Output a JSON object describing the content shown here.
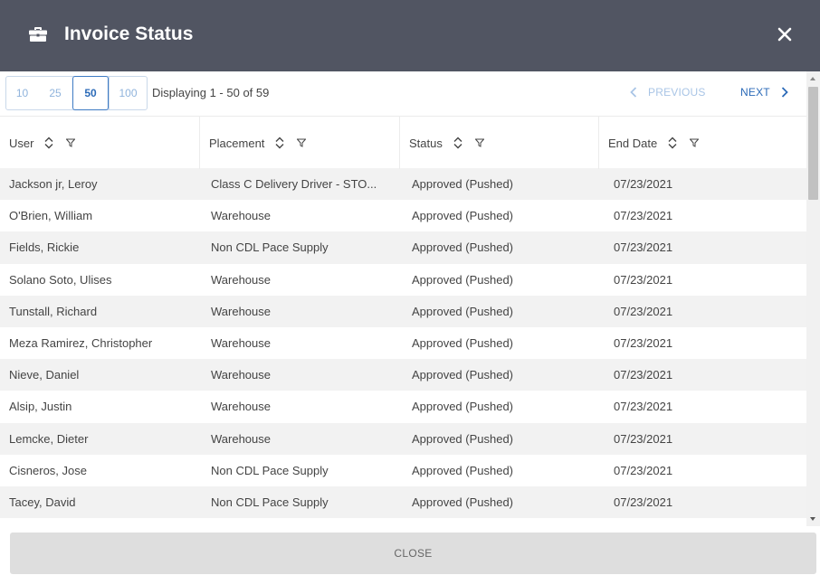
{
  "header": {
    "title": "Invoice Status",
    "title_icon": "briefcase-icon",
    "close_icon": "close-icon",
    "background": "#515562"
  },
  "pager": {
    "page_sizes": [
      "10",
      "25",
      "50",
      "100"
    ],
    "selected_page_size": "50",
    "displaying": "Displaying 1 - 50 of 59",
    "previous_label": "PREVIOUS",
    "next_label": "NEXT",
    "accent": "#2c6bb8"
  },
  "table": {
    "columns": [
      "User",
      "Placement",
      "Status",
      "End Date"
    ],
    "rows": [
      [
        "Jackson jr, Leroy",
        "Class C Delivery Driver - STO...",
        "Approved (Pushed)",
        "07/23/2021"
      ],
      [
        "O'Brien, William",
        "Warehouse",
        "Approved (Pushed)",
        "07/23/2021"
      ],
      [
        "Fields, Rickie",
        "Non CDL Pace Supply",
        "Approved (Pushed)",
        "07/23/2021"
      ],
      [
        "Solano Soto, Ulises",
        "Warehouse",
        "Approved (Pushed)",
        "07/23/2021"
      ],
      [
        "Tunstall, Richard",
        "Warehouse",
        "Approved (Pushed)",
        "07/23/2021"
      ],
      [
        "Meza Ramirez, Christopher",
        "Warehouse",
        "Approved (Pushed)",
        "07/23/2021"
      ],
      [
        "Nieve, Daniel",
        "Warehouse",
        "Approved (Pushed)",
        "07/23/2021"
      ],
      [
        "Alsip, Justin",
        "Warehouse",
        "Approved (Pushed)",
        "07/23/2021"
      ],
      [
        "Lemcke, Dieter",
        "Warehouse",
        "Approved (Pushed)",
        "07/23/2021"
      ],
      [
        "Cisneros, Jose",
        "Non CDL Pace Supply",
        "Approved (Pushed)",
        "07/23/2021"
      ],
      [
        "Tacey, David",
        "Non CDL Pace Supply",
        "Approved (Pushed)",
        "07/23/2021"
      ]
    ]
  },
  "footer": {
    "close_label": "CLOSE"
  }
}
